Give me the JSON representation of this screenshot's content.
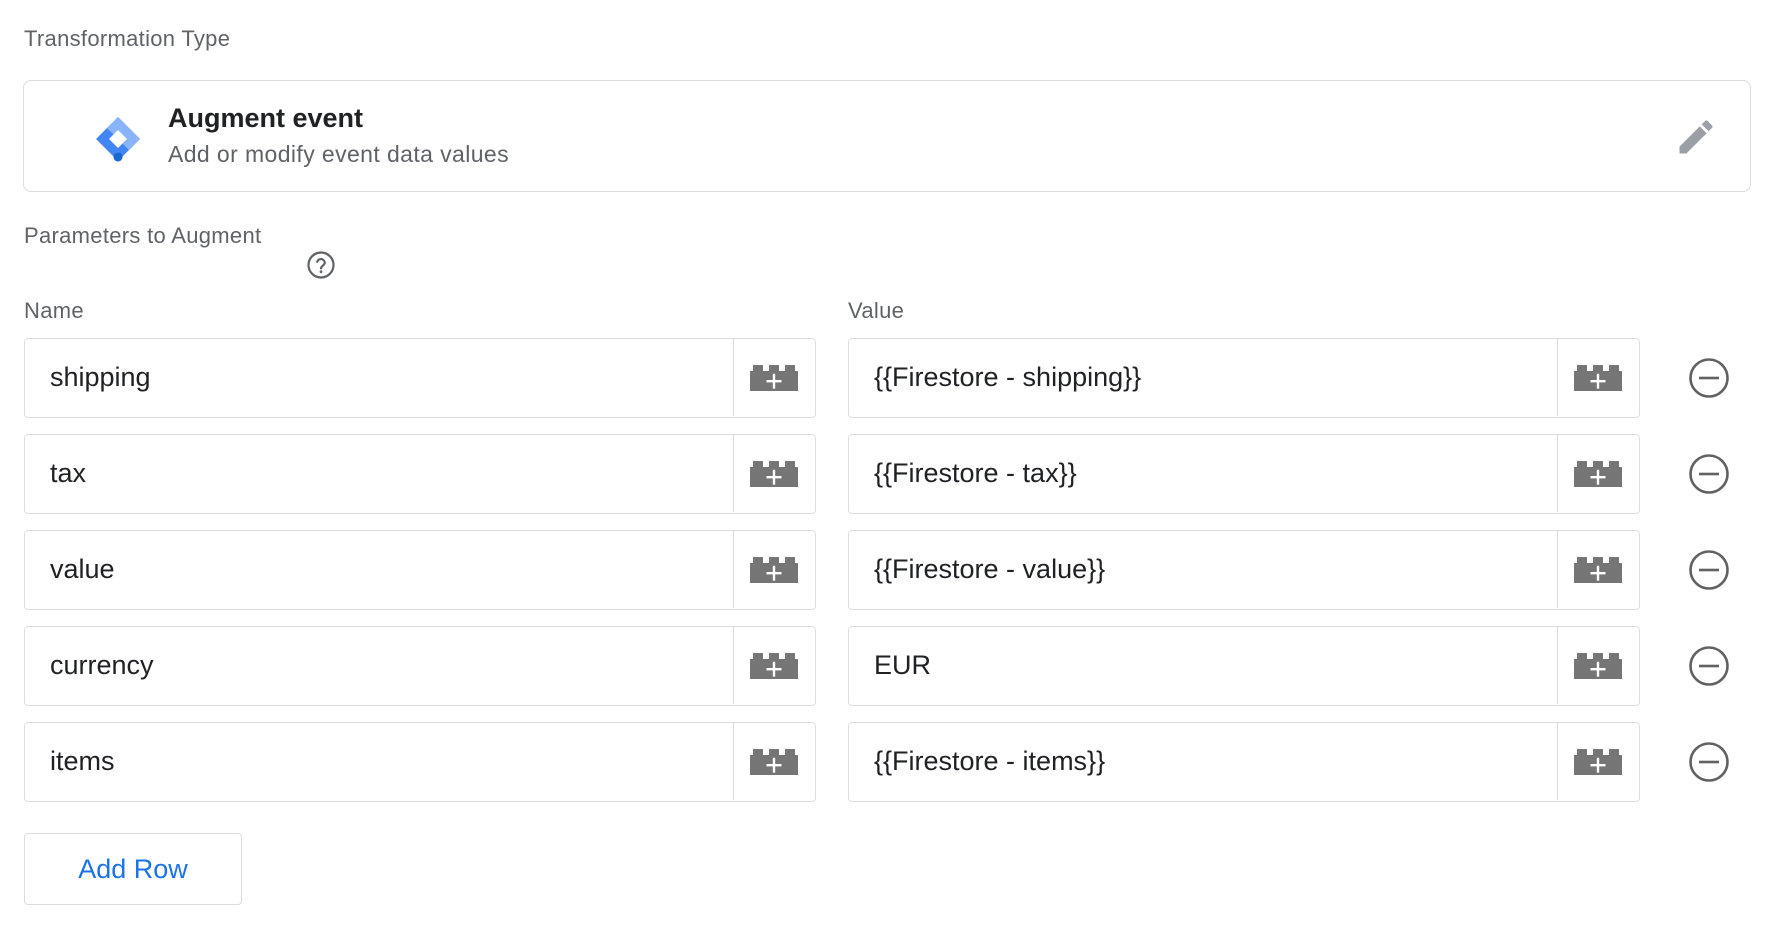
{
  "transformation_type": {
    "label": "Transformation Type",
    "title": "Augment event",
    "subtitle": "Add or modify event data values",
    "logo_icon": "tag-manager-diamond-icon",
    "edit_icon": "pencil-icon"
  },
  "parameters": {
    "label": "Parameters to Augment",
    "help_icon": "help-circle-icon",
    "name_header": "Name",
    "value_header": "Value",
    "variable_icon": "variable-brick-plus-icon",
    "remove_icon": "minus-circle-icon",
    "rows": [
      {
        "name": "shipping",
        "value": "{{Firestore - shipping}}"
      },
      {
        "name": "tax",
        "value": "{{Firestore - tax}}"
      },
      {
        "name": "value",
        "value": "{{Firestore - value}}"
      },
      {
        "name": "currency",
        "value": "EUR"
      },
      {
        "name": "items",
        "value": "{{Firestore - items}}"
      }
    ],
    "add_row_label": "Add Row"
  },
  "colors": {
    "accent": "#1a73e8",
    "border": "#dadce0",
    "secondary_text": "#5f6368",
    "icon_gray": "#757575"
  }
}
